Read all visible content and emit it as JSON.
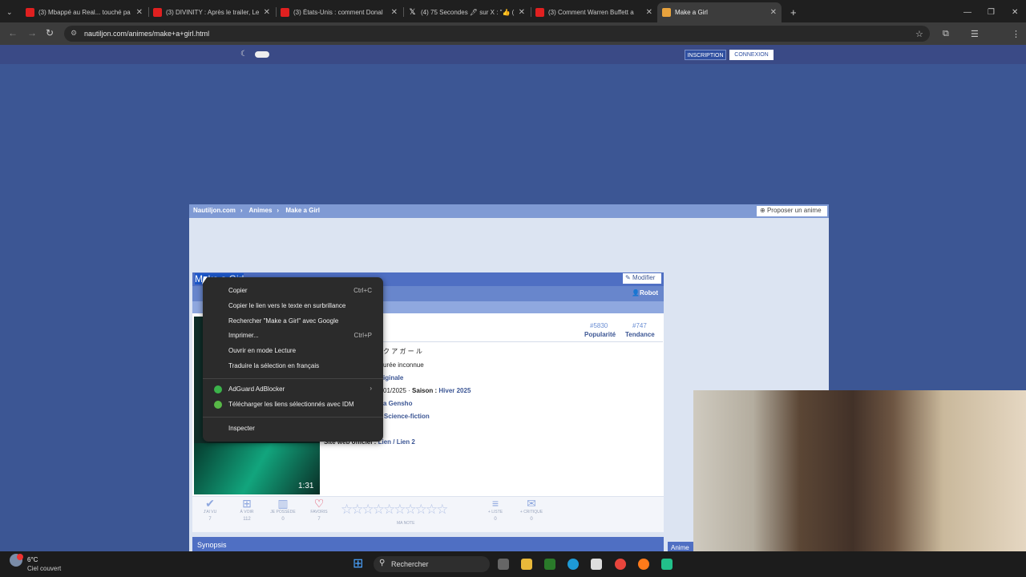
{
  "browser": {
    "tabs": [
      {
        "title": "(3) Mbappé au Real... touché pa",
        "color": "#e02020"
      },
      {
        "title": "(3) DIVINITY : Après le trailer, Le",
        "color": "#e02020"
      },
      {
        "title": "(3) États-Unis : comment Donal",
        "color": "#e02020"
      },
      {
        "title": "(4) 75 Secondes 🖋 sur X : \"👍 (",
        "color": "#ffffff"
      },
      {
        "title": "(3) Comment Warren Buffett a ",
        "color": "#e02020"
      },
      {
        "title": "Make a Girl",
        "color": "#e8a33d"
      }
    ],
    "new_tab": "+",
    "url": "nautiljon.com/animes/make+a+girl.html",
    "window_controls": [
      "—",
      "❐",
      "✕"
    ]
  },
  "site": {
    "btn_inscription": "INSCRIPTION",
    "btn_connexion": "CONNEXION",
    "breadcrumb": [
      "Nautiljon.com",
      "Animes",
      "Make a Girl"
    ],
    "propose": "Proposer un anime",
    "title": "Make a Girl",
    "modifier": "Modifier",
    "robot": "Robot",
    "popularity_rank": "#5830",
    "popularity_label": "Popularité",
    "trend_rank": "#747",
    "trend_label": "Tendance",
    "info": {
      "title_jp": "ク ア ガ ー ル",
      "duration": "urée inconnue",
      "type": "iginale",
      "date": "01/2025 · ",
      "season_label": "Saison : ",
      "season": "Hiver 2025",
      "studio": "a Gensho",
      "genre": "· Science-fiction",
      "site_label": "Site web officiel : ",
      "site_links": "Lien / Lien 2"
    },
    "poster_number": "1:31",
    "actions": [
      {
        "label": "J'AI VU",
        "count": "7",
        "icon": "check-circle-icon",
        "glyph": "✔"
      },
      {
        "label": "À VOIR",
        "count": "112",
        "icon": "add-queue-icon",
        "glyph": "⊞"
      },
      {
        "label": "JE POSSÈDE",
        "count": "0",
        "icon": "library-icon",
        "glyph": "▥"
      },
      {
        "label": "FAVORIS",
        "count": "7",
        "icon": "heart-icon",
        "glyph": "♡"
      }
    ],
    "stars": "☆☆☆☆☆☆☆☆☆☆",
    "ma_note": "MA NOTE",
    "list_label": "+ LISTE",
    "list_count": "0",
    "critique_label": "+ CRITIQUE",
    "critique_count": "0",
    "synopsis": "Synopsis",
    "animes_tab": "Anime"
  },
  "context_menu": {
    "items": [
      {
        "label": "Copier",
        "shortcut": "Ctrl+C"
      },
      {
        "label": "Copier le lien vers le texte en surbrillance",
        "shortcut": ""
      },
      {
        "label": "Rechercher \"Make a Girl\" avec Google",
        "shortcut": ""
      },
      {
        "label": "Imprimer...",
        "shortcut": "Ctrl+P"
      },
      {
        "label": "Ouvrir en mode Lecture",
        "shortcut": ""
      },
      {
        "label": "Traduire la sélection en français",
        "shortcut": ""
      },
      {
        "label": "AdGuard AdBlocker",
        "shortcut": "›"
      },
      {
        "label": "Télécharger les liens sélectionnés avec IDM",
        "shortcut": ""
      },
      {
        "label": "Inspecter",
        "shortcut": ""
      }
    ]
  },
  "taskbar": {
    "temperature": "6°C",
    "weather": "Ciel couvert",
    "search": "Rechercher",
    "badge": "2"
  }
}
